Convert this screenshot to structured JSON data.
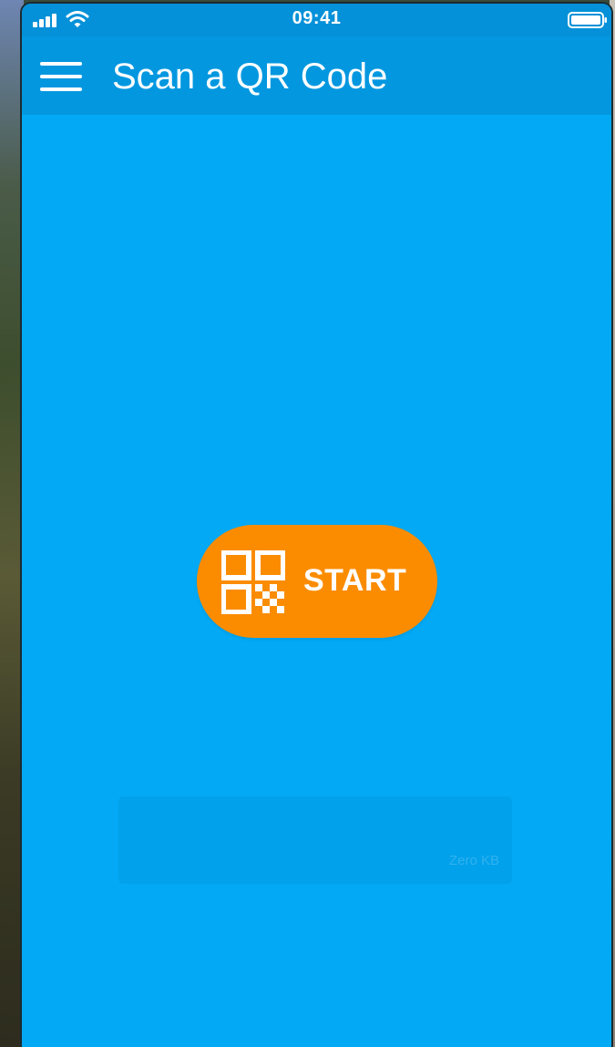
{
  "status_bar": {
    "time": "09:41",
    "icons": [
      "signal-icon",
      "wifi-icon",
      "battery-icon"
    ]
  },
  "app_bar": {
    "title": "Scan a QR Code",
    "menu_icon": "hamburger-menu-icon"
  },
  "main": {
    "start_button": {
      "label": "START",
      "icon": "qr-code-icon"
    }
  },
  "overlay": {
    "size_text": "Zero KB"
  },
  "colors": {
    "background": "#03a9f4",
    "app_bar": "#0397e0",
    "status_bar": "#0591d9",
    "accent": "#fb8c00",
    "text": "#ffffff"
  }
}
